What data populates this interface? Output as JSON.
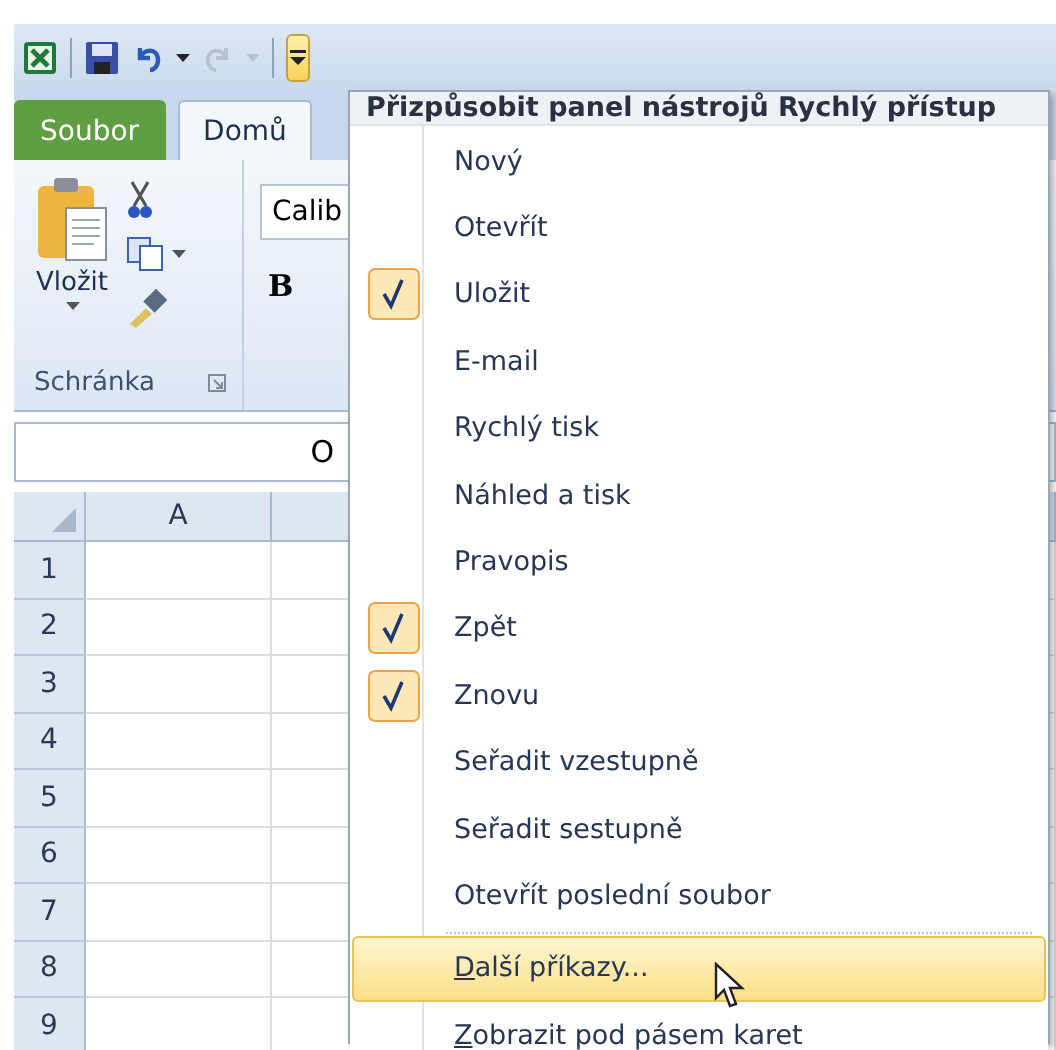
{
  "quick_access": {
    "customize_active": true
  },
  "tabs": [
    {
      "label": "Soubor",
      "kind": "file",
      "selected": false
    },
    {
      "label": "Domů",
      "kind": "tab",
      "selected": true
    }
  ],
  "clipboard": {
    "paste_label": "Vložit",
    "group_label": "Schránka"
  },
  "font": {
    "font_name": "Calib",
    "bold_label": "B"
  },
  "formula_bar": {
    "text": "O"
  },
  "grid": {
    "columns": [
      "A"
    ],
    "rows": [
      "1",
      "2",
      "3",
      "4",
      "5",
      "6",
      "7",
      "8",
      "9"
    ]
  },
  "menu": {
    "title": "Přizpůsobit panel nástrojů Rychlý přístup",
    "commands": [
      {
        "label": "Nový",
        "checked": false
      },
      {
        "label": "Otevřít",
        "checked": false
      },
      {
        "label": "Uložit",
        "checked": true
      },
      {
        "label": "E-mail",
        "checked": false
      },
      {
        "label": "Rychlý tisk",
        "checked": false
      },
      {
        "label": "Náhled a tisk",
        "checked": false
      },
      {
        "label": "Pravopis",
        "checked": false
      },
      {
        "label": "Zpět",
        "checked": true
      },
      {
        "label": "Znovu",
        "checked": true
      },
      {
        "label": "Seřadit vzestupně",
        "checked": false
      },
      {
        "label": "Seřadit sestupně",
        "checked": false
      },
      {
        "label": "Otevřít poslední soubor",
        "checked": false
      }
    ],
    "options": [
      {
        "label": "Další příkazy...",
        "highlighted": true,
        "underline_first": true
      },
      {
        "label": "Zobrazit pod pásem karet",
        "highlighted": false,
        "underline_first": true
      }
    ]
  }
}
